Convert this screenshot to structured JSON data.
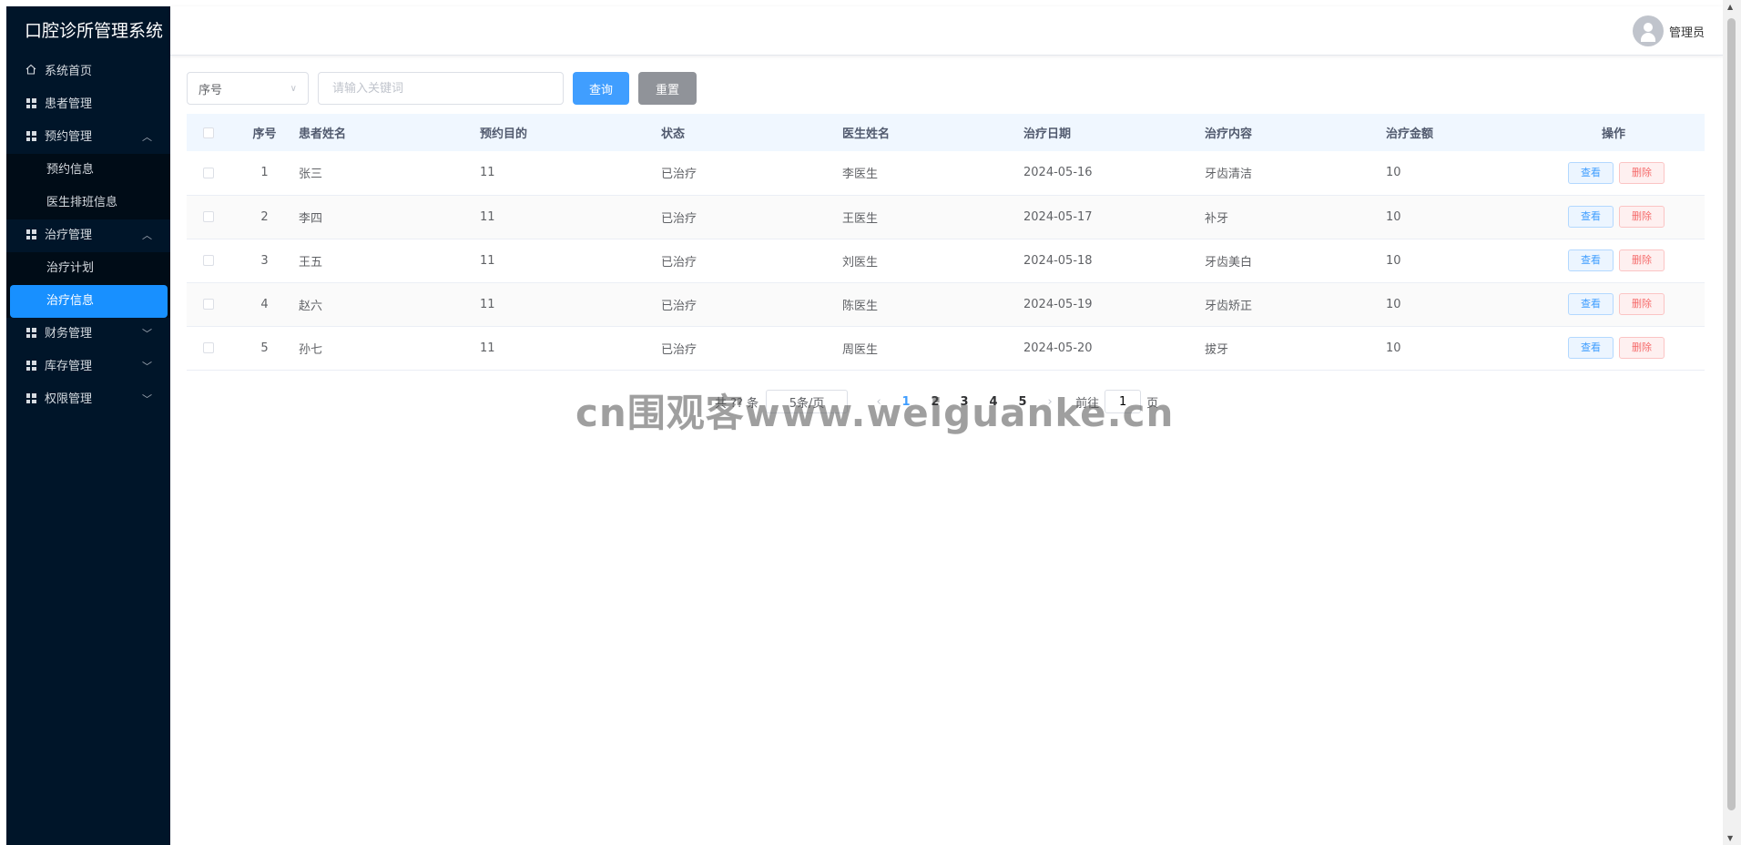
{
  "app": {
    "title": "口腔诊所管理系统"
  },
  "sidebar": {
    "items": [
      {
        "label": "系统首页",
        "icon": "home-icon"
      },
      {
        "label": "患者管理",
        "icon": "grid-icon"
      },
      {
        "label": "预约管理",
        "icon": "grid-icon",
        "expanded": true,
        "children": [
          {
            "label": "预约信息"
          },
          {
            "label": "医生排班信息"
          }
        ]
      },
      {
        "label": "治疗管理",
        "icon": "grid-icon",
        "expanded": true,
        "children": [
          {
            "label": "治疗计划"
          },
          {
            "label": "治疗信息",
            "active": true
          }
        ]
      },
      {
        "label": "财务管理",
        "icon": "grid-icon"
      },
      {
        "label": "库存管理",
        "icon": "grid-icon"
      },
      {
        "label": "权限管理",
        "icon": "grid-icon"
      }
    ]
  },
  "header": {
    "username": "管理员",
    "avatar_icon": "user-icon"
  },
  "search": {
    "select_value": "序号",
    "placeholder": "请输入关键词",
    "query_label": "查询",
    "reset_label": "重置"
  },
  "table": {
    "columns": [
      "序号",
      "患者姓名",
      "预约目的",
      "状态",
      "医生姓名",
      "治疗日期",
      "治疗内容",
      "治疗金额",
      "操作"
    ],
    "rows": [
      {
        "id": "1",
        "patient": "张三",
        "purpose": "11",
        "status": "已治疗",
        "doctor": "李医生",
        "date": "2024-05-16",
        "content": "牙齿清洁",
        "amount": "10"
      },
      {
        "id": "2",
        "patient": "李四",
        "purpose": "11",
        "status": "已治疗",
        "doctor": "王医生",
        "date": "2024-05-17",
        "content": "补牙",
        "amount": "10"
      },
      {
        "id": "3",
        "patient": "王五",
        "purpose": "11",
        "status": "已治疗",
        "doctor": "刘医生",
        "date": "2024-05-18",
        "content": "牙齿美白",
        "amount": "10"
      },
      {
        "id": "4",
        "patient": "赵六",
        "purpose": "11",
        "status": "已治疗",
        "doctor": "陈医生",
        "date": "2024-05-19",
        "content": "牙齿矫正",
        "amount": "10"
      },
      {
        "id": "5",
        "patient": "孙七",
        "purpose": "11",
        "status": "已治疗",
        "doctor": "周医生",
        "date": "2024-05-20",
        "content": "拔牙",
        "amount": "10"
      }
    ],
    "view_label": "查看",
    "delete_label": "删除"
  },
  "pagination": {
    "total_text": "共 ?? 条",
    "page_size": "5条/页",
    "pages": [
      "1",
      "2",
      "3",
      "4",
      "5"
    ],
    "current_page": "1",
    "goto_prefix": "前往",
    "goto_value": "1",
    "goto_suffix": "页"
  },
  "watermark": "cn围观客www.weiguanke.cn",
  "colors": {
    "sidebar_bg": "#001529",
    "active": "#1890ff",
    "primary": "#409eff",
    "danger": "#f56c6c"
  }
}
